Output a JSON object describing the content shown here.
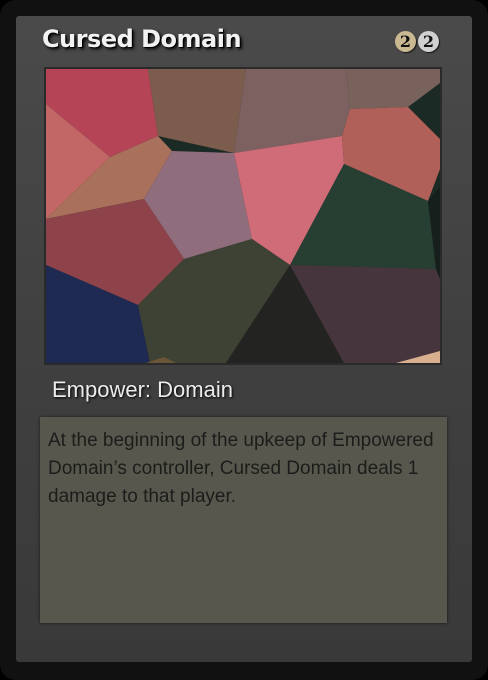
{
  "card": {
    "name": "Cursed Domain",
    "mana_cost": [
      {
        "symbol": "2",
        "color": "#c9b892"
      },
      {
        "symbol": "2",
        "color": "#cfd0cf"
      }
    ],
    "type_line": "Empower: Domain",
    "rules_text": "At the beginning of the upkeep of Empowered Domain’s controller, Cursed Domain deals 1 damage to that player."
  }
}
